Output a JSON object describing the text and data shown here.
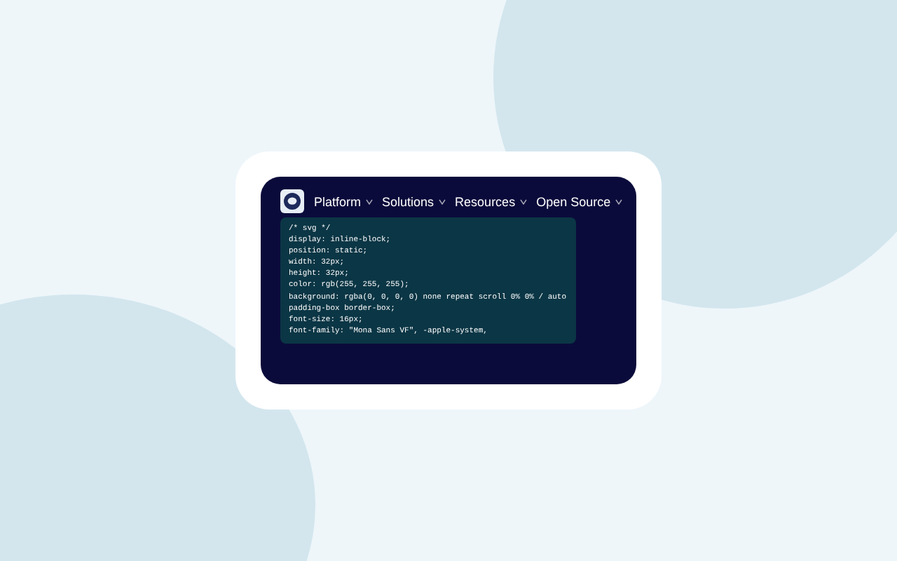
{
  "nav": {
    "items": [
      {
        "label": "Platform",
        "expanded": false
      },
      {
        "label": "Solutions",
        "expanded": false
      },
      {
        "label": "Resources",
        "expanded": false
      },
      {
        "label": "Open Source",
        "expanded": false
      }
    ]
  },
  "style_tooltip": {
    "lines": [
      "/* svg */",
      "display: inline-block;",
      "position: static;",
      "width: 32px;",
      "height: 32px;",
      "color: rgb(255, 255, 255);",
      "background: rgba(0, 0, 0, 0) none repeat scroll 0% 0% / auto",
      "padding-box border-box;",
      "font-size: 16px;",
      "font-family: \"Mona Sans VF\", -apple-system,"
    ]
  }
}
